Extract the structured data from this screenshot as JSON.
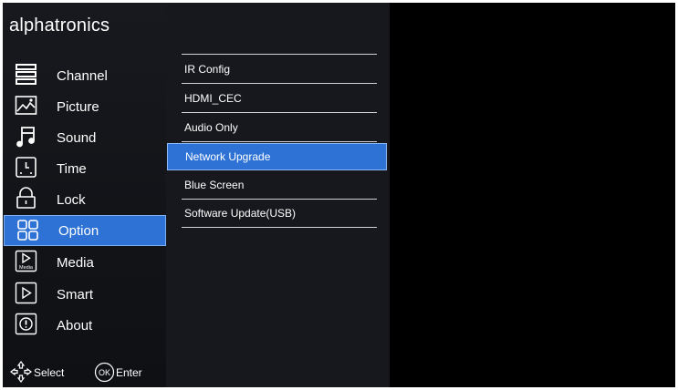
{
  "brand": "alphatronics",
  "menu": [
    {
      "label": "Channel",
      "icon": "channel-list-icon"
    },
    {
      "label": "Picture",
      "icon": "picture-icon"
    },
    {
      "label": "Sound",
      "icon": "music-note-icon"
    },
    {
      "label": "Time",
      "icon": "time-icon"
    },
    {
      "label": "Lock",
      "icon": "lock-icon"
    },
    {
      "label": "Option",
      "icon": "option-grid-icon",
      "selected": true
    },
    {
      "label": "Media",
      "icon": "media-play-icon"
    },
    {
      "label": "Smart",
      "icon": "smart-play-icon"
    },
    {
      "label": "About",
      "icon": "info-icon"
    }
  ],
  "submenu": [
    {
      "label": "IR Config"
    },
    {
      "label": "HDMI_CEC"
    },
    {
      "label": "Audio Only"
    },
    {
      "label": "Network Upgrade",
      "selected": true
    },
    {
      "label": "Blue Screen"
    },
    {
      "label": "Software Update(USB)"
    }
  ],
  "hints": {
    "select_label": "Select",
    "ok_label": "OK",
    "enter_label": "Enter"
  },
  "icons": {
    "media_icon_caption": "Media"
  },
  "colors": {
    "highlight": "#2e72d6",
    "panel": "#16181d",
    "background": "#000000"
  }
}
